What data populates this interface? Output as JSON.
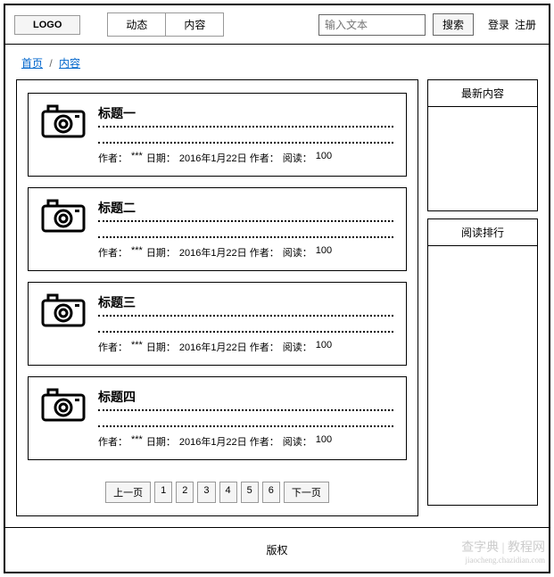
{
  "header": {
    "logo": "LOGO",
    "nav": [
      "动态",
      "内容"
    ],
    "search_placeholder": "输入文本",
    "search_button": "搜索",
    "login": "登录",
    "register": "注册"
  },
  "breadcrumb": {
    "home": "首页",
    "sep": "/",
    "current": "内容"
  },
  "articles": [
    {
      "title": "标题一",
      "author_label": "作者：",
      "author": "***",
      "date_label": "日期：",
      "date": "2016年1月22日 作者：",
      "reads_label": "阅读：",
      "reads": "100"
    },
    {
      "title": "标题二",
      "author_label": "作者：",
      "author": "***",
      "date_label": "日期：",
      "date": "2016年1月22日 作者：",
      "reads_label": "阅读：",
      "reads": "100"
    },
    {
      "title": "标题三",
      "author_label": "作者：",
      "author": "***",
      "date_label": "日期：",
      "date": "2016年1月22日 作者：",
      "reads_label": "阅读：",
      "reads": "100"
    },
    {
      "title": "标题四",
      "author_label": "作者：",
      "author": "***",
      "date_label": "日期：",
      "date": "2016年1月22日 作者：",
      "reads_label": "阅读：",
      "reads": "100"
    }
  ],
  "pagination": {
    "prev": "上一页",
    "pages": [
      "1",
      "2",
      "3",
      "4",
      "5",
      "6"
    ],
    "next": "下一页"
  },
  "sidebar": {
    "latest": "最新内容",
    "ranking": "阅读排行"
  },
  "footer": {
    "copyright": "版权"
  },
  "watermark": {
    "main": "查字典 | 教程网",
    "sub": "jiaocheng.chazidian.com"
  }
}
